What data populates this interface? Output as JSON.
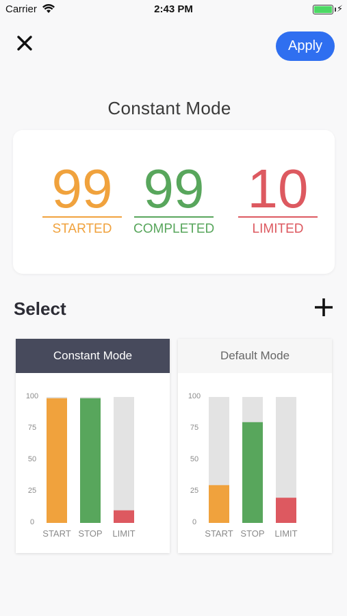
{
  "status_bar": {
    "carrier": "Carrier",
    "time": "2:43 PM"
  },
  "nav": {
    "apply_label": "Apply",
    "close_icon": "close-icon"
  },
  "page_title": "Constant Mode",
  "summary": {
    "stats": [
      {
        "value": "99",
        "label": "STARTED",
        "color": "#f0a23d"
      },
      {
        "value": "99",
        "label": "COMPLETED",
        "color": "#58a65c"
      },
      {
        "value": "10",
        "label": "LIMITED",
        "color": "#dd5960"
      }
    ]
  },
  "select_section": {
    "title": "Select",
    "add_icon": "plus-icon"
  },
  "modes": [
    {
      "name": "Constant Mode",
      "selected": true,
      "chart_data": {
        "type": "bar",
        "categories": [
          "START",
          "STOP",
          "LIMIT"
        ],
        "values": [
          99,
          99,
          10
        ],
        "max": 100,
        "yticks": [
          "100",
          "75",
          "50",
          "25",
          "0"
        ],
        "colors": [
          "#f0a23d",
          "#58a65c",
          "#dd5960"
        ]
      }
    },
    {
      "name": "Default Mode",
      "selected": false,
      "chart_data": {
        "type": "bar",
        "categories": [
          "START",
          "STOP",
          "LIMIT"
        ],
        "values": [
          30,
          80,
          20
        ],
        "max": 100,
        "yticks": [
          "100",
          "75",
          "50",
          "25",
          "0"
        ],
        "colors": [
          "#f0a23d",
          "#58a65c",
          "#dd5960"
        ]
      }
    }
  ]
}
